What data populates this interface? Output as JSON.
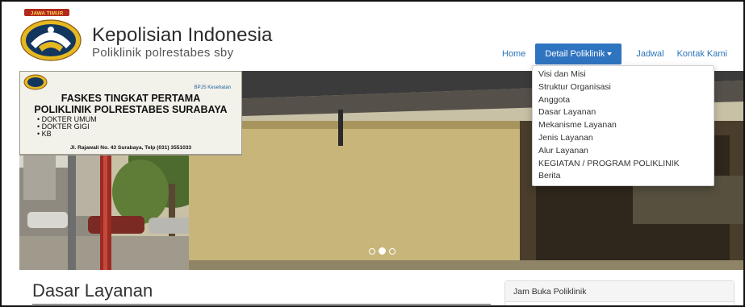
{
  "brand": {
    "logo_label": "JAWA TIMUR",
    "title": "Kepolisian Indonesia",
    "subtitle": "Poliklinik polrestabes sby"
  },
  "nav": {
    "items": [
      {
        "label": "Home"
      },
      {
        "label": "Detail Poliklinik"
      },
      {
        "label": "Jadwal"
      },
      {
        "label": "Kontak Kami"
      }
    ],
    "active_index": 1
  },
  "dropdown": {
    "items": [
      "Visi dan Misi",
      "Struktur Organisasi",
      "Anggota",
      "Dasar Layanan",
      "Mekanisme Layanan",
      "Jenis Layanan",
      "Alur Layanan",
      "KEGIATAN / PROGRAM POLIKLINIK",
      "Berita"
    ]
  },
  "carousel": {
    "sign": {
      "logo_text": "BPJS Kesehatan",
      "line1": "FASKES TINGKAT PERTAMA",
      "line2": "POLIKLINIK POLRESTABES SURABAYA",
      "services": [
        "• DOKTER UMUM",
        "• DOKTER GIGI",
        "• KB"
      ],
      "address": "Jl. Rajawali No. 43 Surabaya, Telp (031) 3551033"
    },
    "slide_count": 3,
    "active_slide": 2
  },
  "content": {
    "page_title": "Dasar Layanan"
  },
  "sidebar_panel": {
    "heading": "Jam Buka Poliklinik"
  },
  "colors": {
    "nav_active_bg": "#2f74c0",
    "link": "#2a73b8",
    "wall": "#c7b57a"
  }
}
